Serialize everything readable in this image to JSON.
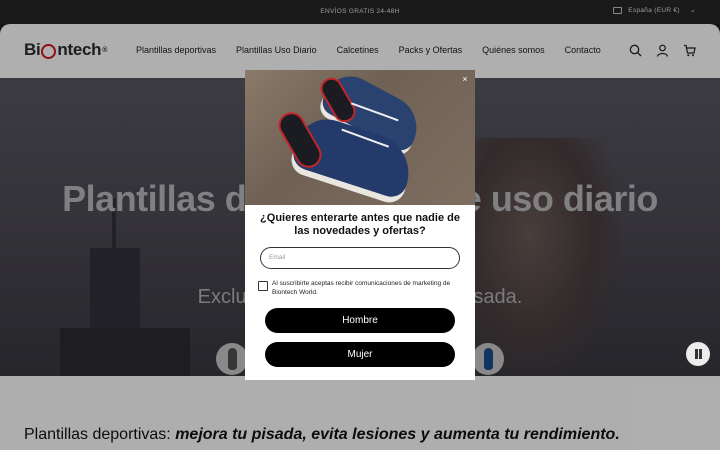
{
  "announcement": {
    "text": "ENVÍOS GRATIS 24-48H",
    "region": "España (EUR €)"
  },
  "header": {
    "logo": {
      "part1": "Bi",
      "part2": "n",
      "part3": "tech",
      "reg": "®"
    },
    "nav": [
      "Plantillas deportivas",
      "Plantillas Uso Diario",
      "Calcetines",
      "Packs y Ofertas",
      "Quiénes somos",
      "Contacto"
    ],
    "icons": [
      "search-icon",
      "account-icon",
      "cart-icon"
    ]
  },
  "hero": {
    "title": "Plantillas deportivas y de uso diario",
    "subtitle": "Exclusivas para cada tipo de pisada."
  },
  "section": {
    "title_plain": "Plantillas deportivas: ",
    "title_em": "mejora tu pisada, evita lesiones y aumenta tu rendimiento."
  },
  "popup": {
    "close": "×",
    "question": "¿Quieres enterarte antes que nadie de las novedades y ofertas?",
    "email_placeholder": "Email",
    "consent": "Al suscribirte aceptas recibir comunicaciones de marketing de Biontech World.",
    "button_1": "Hombre",
    "button_2": "Mujer"
  },
  "colors": {
    "brand_red": "#c4161c",
    "button_bg": "#000000",
    "announcement_bg": "#252525"
  }
}
